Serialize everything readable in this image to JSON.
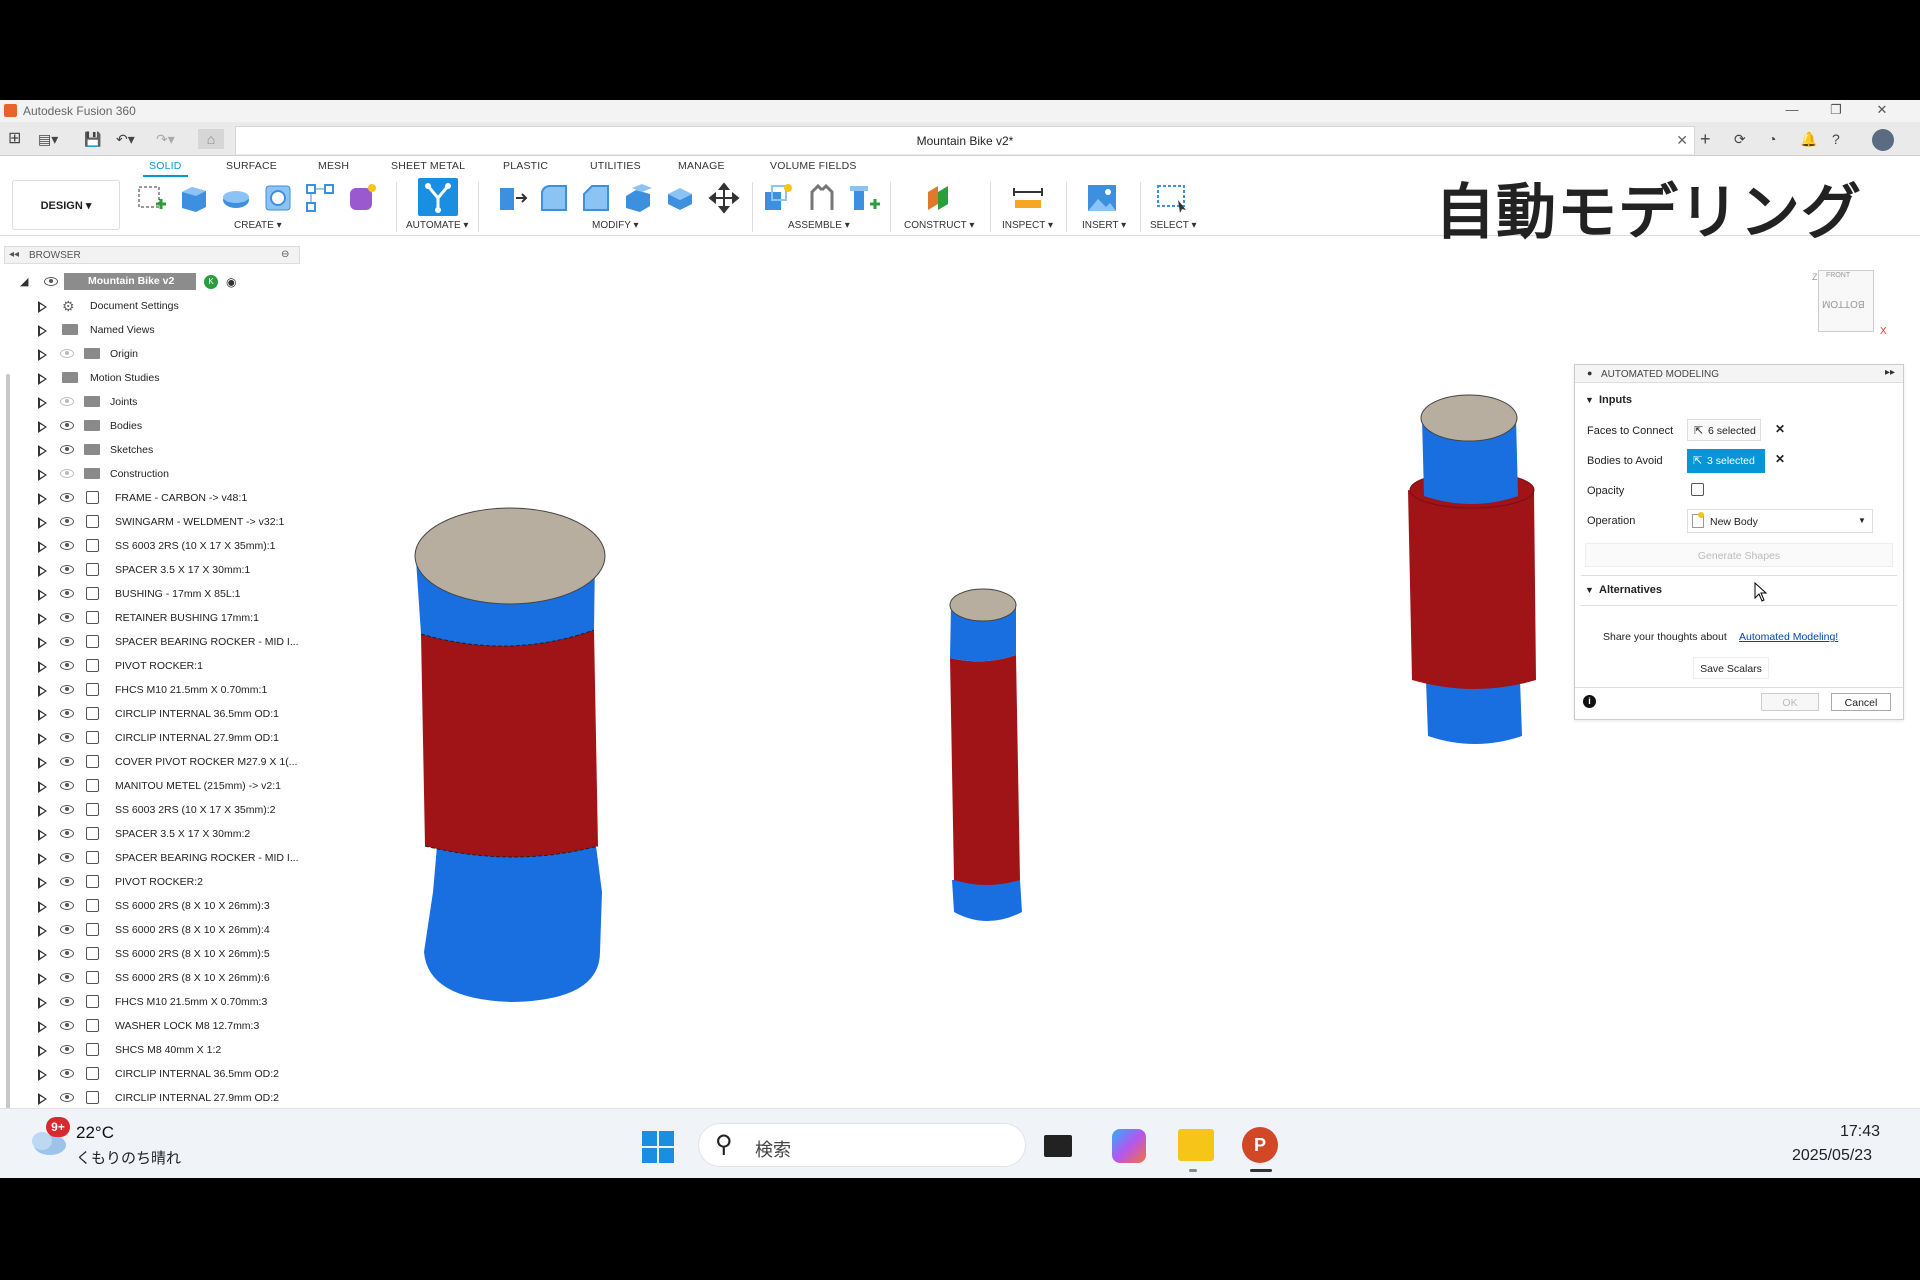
{
  "app_title": "Autodesk Fusion 360",
  "window_controls": {
    "min": "—",
    "max": "❐",
    "close": "✕"
  },
  "document_tab": {
    "title": "Mountain Bike v2*"
  },
  "ribbon": {
    "tabs": [
      "SOLID",
      "SURFACE",
      "MESH",
      "SHEET METAL",
      "PLASTIC",
      "UTILITIES",
      "MANAGE",
      "VOLUME FIELDS"
    ],
    "active_tab": "SOLID",
    "workspace": "DESIGN ▾",
    "groups": [
      "CREATE ▾",
      "AUTOMATE ▾",
      "MODIFY ▾",
      "ASSEMBLE ▾",
      "CONSTRUCT ▾",
      "INSPECT ▾",
      "INSERT ▾",
      "SELECT ▾"
    ]
  },
  "overlay_title": "自動モデリング",
  "browser": {
    "header": "BROWSER",
    "root": "Mountain Bike v2",
    "items": [
      {
        "label": "Document Settings",
        "icon": "gear"
      },
      {
        "label": "Named Views",
        "icon": "folder"
      },
      {
        "label": "Origin",
        "icon": "folder",
        "eye": "dim"
      },
      {
        "label": "Motion Studies",
        "icon": "folder"
      },
      {
        "label": "Joints",
        "icon": "folder",
        "eye": "dim"
      },
      {
        "label": "Bodies",
        "icon": "folder",
        "eye": "on"
      },
      {
        "label": "Sketches",
        "icon": "folder",
        "eye": "on"
      },
      {
        "label": "Construction",
        "icon": "folder",
        "eye": "dim"
      },
      {
        "label": "FRAME - CARBON -> v48:1",
        "icon": "comp",
        "eye": "on"
      },
      {
        "label": "SWINGARM - WELDMENT -> v32:1",
        "icon": "comp",
        "eye": "on"
      },
      {
        "label": "SS 6003 2RS (10 X 17 X 35mm):1",
        "icon": "comp",
        "eye": "on"
      },
      {
        "label": "SPACER 3.5 X 17 X 30mm:1",
        "icon": "comp",
        "eye": "on"
      },
      {
        "label": "BUSHING - 17mm X 85L:1",
        "icon": "comp",
        "eye": "on"
      },
      {
        "label": "RETAINER BUSHING 17mm:1",
        "icon": "comp",
        "eye": "on"
      },
      {
        "label": "SPACER BEARING ROCKER - MID I...",
        "icon": "comp",
        "eye": "on"
      },
      {
        "label": "PIVOT ROCKER:1",
        "icon": "comp",
        "eye": "on"
      },
      {
        "label": "FHCS M10 21.5mm X 0.70mm:1",
        "icon": "comp",
        "eye": "on"
      },
      {
        "label": "CIRCLIP INTERNAL 36.5mm OD:1",
        "icon": "comp",
        "eye": "on"
      },
      {
        "label": "CIRCLIP INTERNAL 27.9mm OD:1",
        "icon": "comp",
        "eye": "on"
      },
      {
        "label": "COVER PIVOT ROCKER M27.9 X 1(...",
        "icon": "comp",
        "eye": "on"
      },
      {
        "label": "MANITOU METEL (215mm) -> v2:1",
        "icon": "comp",
        "eye": "on"
      },
      {
        "label": "SS 6003 2RS (10 X 17 X 35mm):2",
        "icon": "comp",
        "eye": "on"
      },
      {
        "label": "SPACER 3.5 X 17 X 30mm:2",
        "icon": "comp",
        "eye": "on"
      },
      {
        "label": "SPACER BEARING ROCKER - MID I...",
        "icon": "comp",
        "eye": "on"
      },
      {
        "label": "PIVOT ROCKER:2",
        "icon": "comp",
        "eye": "on"
      },
      {
        "label": "SS 6000 2RS (8 X 10 X 26mm):3",
        "icon": "comp",
        "eye": "on"
      },
      {
        "label": "SS 6000 2RS (8 X 10 X 26mm):4",
        "icon": "comp",
        "eye": "on"
      },
      {
        "label": "SS 6000 2RS (8 X 10 X 26mm):5",
        "icon": "comp",
        "eye": "on"
      },
      {
        "label": "SS 6000 2RS (8 X 10 X 26mm):6",
        "icon": "comp",
        "eye": "on"
      },
      {
        "label": "FHCS M10 21.5mm X 0.70mm:3",
        "icon": "comp",
        "eye": "on"
      },
      {
        "label": "WASHER LOCK M8 12.7mm:3",
        "icon": "comp",
        "eye": "on"
      },
      {
        "label": "SHCS M8 40mm X 1:2",
        "icon": "comp",
        "eye": "on"
      },
      {
        "label": "CIRCLIP INTERNAL 36.5mm OD:2",
        "icon": "comp",
        "eye": "on"
      },
      {
        "label": "CIRCLIP INTERNAL 27.9mm OD:2",
        "icon": "comp",
        "eye": "on"
      }
    ]
  },
  "viewcube": {
    "top": "FRONT",
    "face": "BOTTOM",
    "axis_x": "X",
    "axis_z": "Z"
  },
  "panel": {
    "title": "AUTOMATED MODELING",
    "inputs_header": "Inputs",
    "faces_label": "Faces to Connect",
    "faces_value": "6 selected",
    "bodies_label": "Bodies to Avoid",
    "bodies_value": "3 selected",
    "opacity_label": "Opacity",
    "operation_label": "Operation",
    "operation_value": "New Body",
    "generate": "Generate Shapes",
    "alternatives_header": "Alternatives",
    "feedback_text": "Share your thoughts about",
    "feedback_link": "Automated Modeling!",
    "save_scalars": "Save Scalars",
    "ok": "OK",
    "cancel": "Cancel"
  },
  "colors": {
    "accent": "#0696d7",
    "cyl_blue": "#1a6fe0",
    "cyl_red": "#a01418",
    "cyl_top": "#b8ae9f"
  },
  "taskbar": {
    "temp": "22°C",
    "weather": "くもりのち晴れ",
    "badge": "9+",
    "search_placeholder": "検索",
    "time": "17:43",
    "date": "2025/05/23"
  }
}
